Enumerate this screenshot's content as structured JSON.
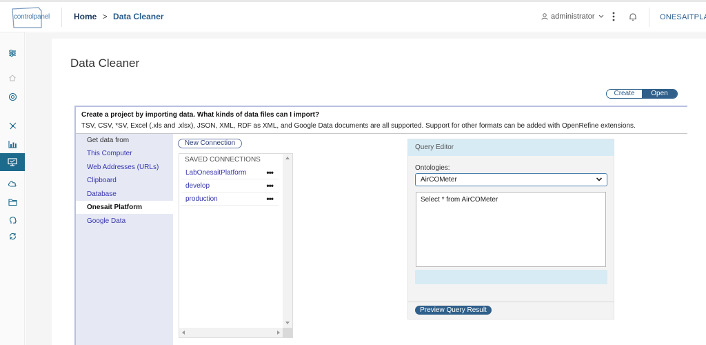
{
  "header": {
    "logo_text": "controlpanel",
    "breadcrumb_home": "Home",
    "breadcrumb_separator": ">",
    "breadcrumb_current": "Data Cleaner",
    "user_name": "administrator",
    "platform_name": "ONESAITPLATFO"
  },
  "sidebar": {
    "icons": [
      "sliders-icon",
      "home-icon",
      "target-icon",
      "network-icon",
      "bar-chart-icon",
      "monitor-icon",
      "cloud-icon",
      "folder-icon",
      "brain-icon",
      "sync-icon"
    ],
    "active": "monitor-icon",
    "accent": "#1c6a8c"
  },
  "page": {
    "title": "Data Cleaner",
    "toggle_create": "Create",
    "toggle_open": "Open"
  },
  "intro": {
    "title": "Create a project by importing data. What kinds of data files can I import?",
    "text": "TSV, CSV, *SV, Excel (.xls and .xlsx), JSON, XML, RDF as XML, and Google Data documents are all supported. Support for other formats can be added with OpenRefine extensions."
  },
  "sources": {
    "header": "Get data from",
    "items": [
      "This Computer",
      "Web Addresses (URLs)",
      "Clipboard",
      "Database",
      "Onesait Platform",
      "Google Data"
    ],
    "selected": "Onesait Platform"
  },
  "connections": {
    "new_button": "New Connection",
    "saved_title": "SAVED CONNECTIONS",
    "items": [
      "LabOnesaitPlatform",
      "develop",
      "production"
    ],
    "menu_glyph": "•••"
  },
  "query_editor": {
    "title": "Query Editor",
    "ontologies_label": "Ontologies:",
    "selected_ontology": "AirCOMeter",
    "query": "Select * from AirCOMeter",
    "preview_button": "Preview Query Result"
  },
  "colors": {
    "brand": "#2f5f8a",
    "link": "#3535b0",
    "panel_header": "#d7ebf4"
  }
}
